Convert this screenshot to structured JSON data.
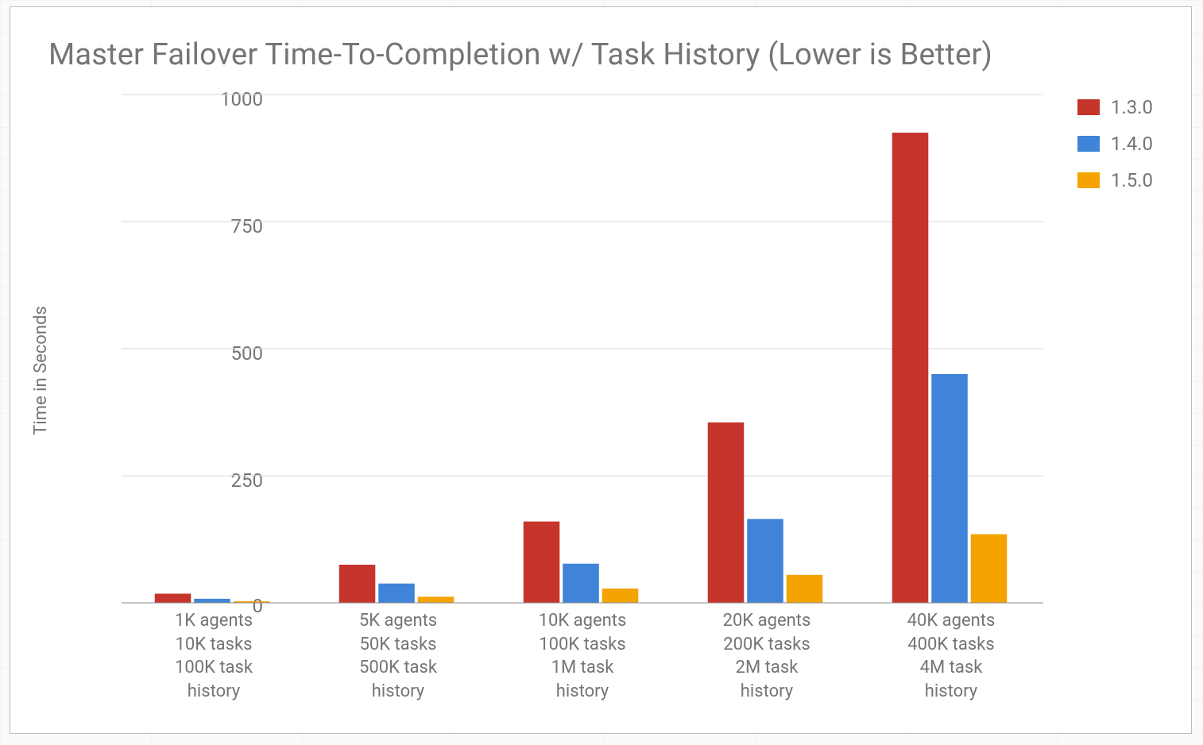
{
  "chart_data": {
    "type": "bar",
    "title": "Master Failover Time-To-Completion w/ Task History (Lower is Better)",
    "ylabel": "Time in Seconds",
    "ylim": [
      0,
      1000
    ],
    "yticks": [
      0,
      250,
      500,
      750,
      1000
    ],
    "categories": [
      [
        "1K agents",
        "10K tasks",
        "100K task",
        "history"
      ],
      [
        "5K agents",
        "50K tasks",
        "500K task",
        "history"
      ],
      [
        "10K agents",
        "100K tasks",
        "1M task",
        "history"
      ],
      [
        "20K agents",
        "200K tasks",
        "2M task",
        "history"
      ],
      [
        "40K agents",
        "400K tasks",
        "4M task",
        "history"
      ]
    ],
    "series": [
      {
        "name": "1.3.0",
        "color": "#c5352b",
        "values": [
          18,
          75,
          160,
          355,
          925
        ]
      },
      {
        "name": "1.4.0",
        "color": "#3f84d8",
        "values": [
          8,
          38,
          77,
          165,
          450
        ]
      },
      {
        "name": "1.5.0",
        "color": "#f4a300",
        "values": [
          3,
          12,
          28,
          55,
          135
        ]
      }
    ]
  }
}
